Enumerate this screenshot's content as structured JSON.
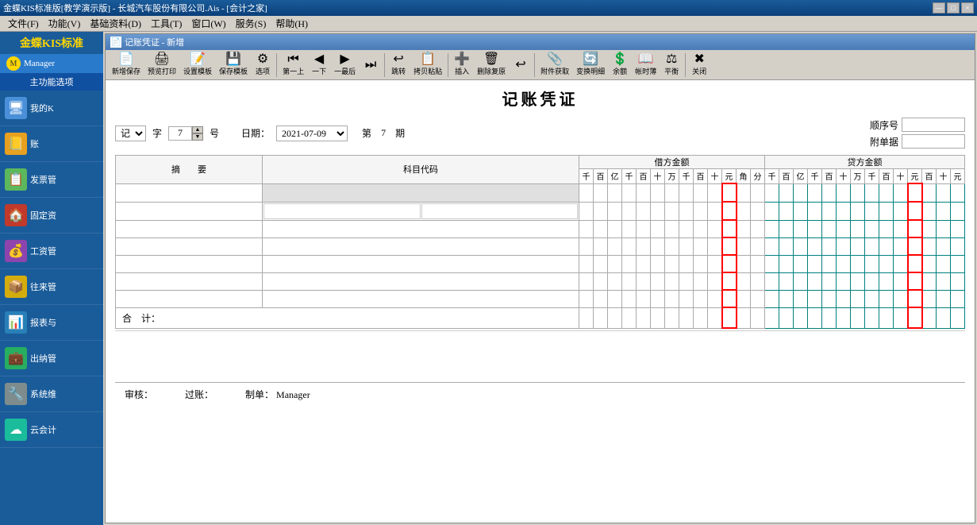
{
  "titleBar": {
    "text": "金蝶KIS标准版[教学演示版] - 长城汽车股份有限公司.Ais - [会计之家]",
    "buttons": [
      "—",
      "□",
      "×"
    ]
  },
  "menuBar": {
    "items": [
      "文件(F)",
      "功能(V)",
      "基础资料(D)",
      "工具(T)",
      "窗口(W)",
      "服务(S)",
      "帮助(H)"
    ]
  },
  "sidebar": {
    "appName": "会计之家",
    "brandName": "金蝶KIS标准",
    "user": "Manager",
    "sectionTitle": "主功能选项",
    "items": [
      {
        "label": "我的K",
        "icon": "🖥"
      },
      {
        "label": "账",
        "icon": "📒"
      },
      {
        "label": "发票管",
        "icon": "📋"
      },
      {
        "label": "固定资",
        "icon": "🏠"
      },
      {
        "label": "工资管",
        "icon": "💰"
      },
      {
        "label": "往来管",
        "icon": "📦"
      },
      {
        "label": "报表与",
        "icon": "📊"
      },
      {
        "label": "出纳管",
        "icon": "💼"
      },
      {
        "label": "系统维",
        "icon": "🔧"
      },
      {
        "label": "云会计",
        "icon": "☁"
      }
    ]
  },
  "docWindow": {
    "title": "记账凭证 - 新增"
  },
  "toolbar": {
    "buttons": [
      {
        "label": "新增保存",
        "icon": "📄"
      },
      {
        "label": "预览打印",
        "icon": "🖨"
      },
      {
        "label": "设置模板",
        "icon": "📝"
      },
      {
        "label": "保存模板",
        "icon": "💾"
      },
      {
        "label": "选项",
        "icon": "⚙"
      },
      {
        "label": "第一上",
        "icon": "⏮"
      },
      {
        "label": "一下",
        "icon": "◀"
      },
      {
        "label": "一最后",
        "icon": "▶"
      },
      {
        "label": "",
        "icon": "⏭"
      },
      {
        "label": "跳转",
        "icon": "↩"
      },
      {
        "label": "拷贝粘贴",
        "icon": "📋"
      },
      {
        "label": "插入",
        "icon": "➕"
      },
      {
        "label": "删除复原",
        "icon": "🗑"
      },
      {
        "label": "",
        "icon": "↩"
      },
      {
        "label": "附件获取",
        "icon": "📎"
      },
      {
        "label": "变换明细",
        "icon": "🔄"
      },
      {
        "label": "余额",
        "icon": "💲"
      },
      {
        "label": "帐时薄",
        "icon": "📖"
      },
      {
        "label": "平衡",
        "icon": "⚖"
      },
      {
        "label": "关闭",
        "icon": "✖"
      }
    ]
  },
  "form": {
    "title": "记账凭证",
    "typeLabel": "记",
    "typeValue": "记",
    "wordLabel": "字",
    "numberValue": "7",
    "numberSuffix": "号",
    "dateLabel": "日期：",
    "dateValue": "2021-07-09",
    "periodLabel": "第",
    "periodValue": "7",
    "periodSuffix": "期",
    "seqLabel": "顺序号",
    "attachLabel": "附单据",
    "tableHeaders": {
      "desc": "摘　　要",
      "code": "科目代码",
      "debit": "借方金额",
      "credit": "贷方金额"
    },
    "amountSubHeaders": {
      "debit": [
        "千",
        "百",
        "亿",
        "千",
        "百",
        "十",
        "万",
        "千",
        "百",
        "十",
        "元",
        "角",
        "分"
      ],
      "credit": [
        "千",
        "百",
        "亿",
        "千",
        "百",
        "十",
        "万",
        "千",
        "百",
        "十",
        "元",
        "百",
        "十",
        "元"
      ]
    },
    "rows": [
      {
        "desc": "",
        "code1": "",
        "code2": ""
      },
      {
        "desc": "",
        "code1": "",
        "code2": ""
      },
      {
        "desc": "",
        "code1": "",
        "code2": ""
      },
      {
        "desc": "",
        "code1": "",
        "code2": ""
      },
      {
        "desc": "",
        "code1": "",
        "code2": ""
      },
      {
        "desc": "",
        "code1": "",
        "code2": ""
      },
      {
        "desc": "",
        "code1": "",
        "code2": ""
      }
    ],
    "totalLabel": "合　计：",
    "footer": {
      "auditLabel": "审核：",
      "auditValue": "",
      "postLabel": "过账：",
      "postValue": "",
      "makerLabel": "制单：",
      "makerValue": "Manager"
    }
  }
}
